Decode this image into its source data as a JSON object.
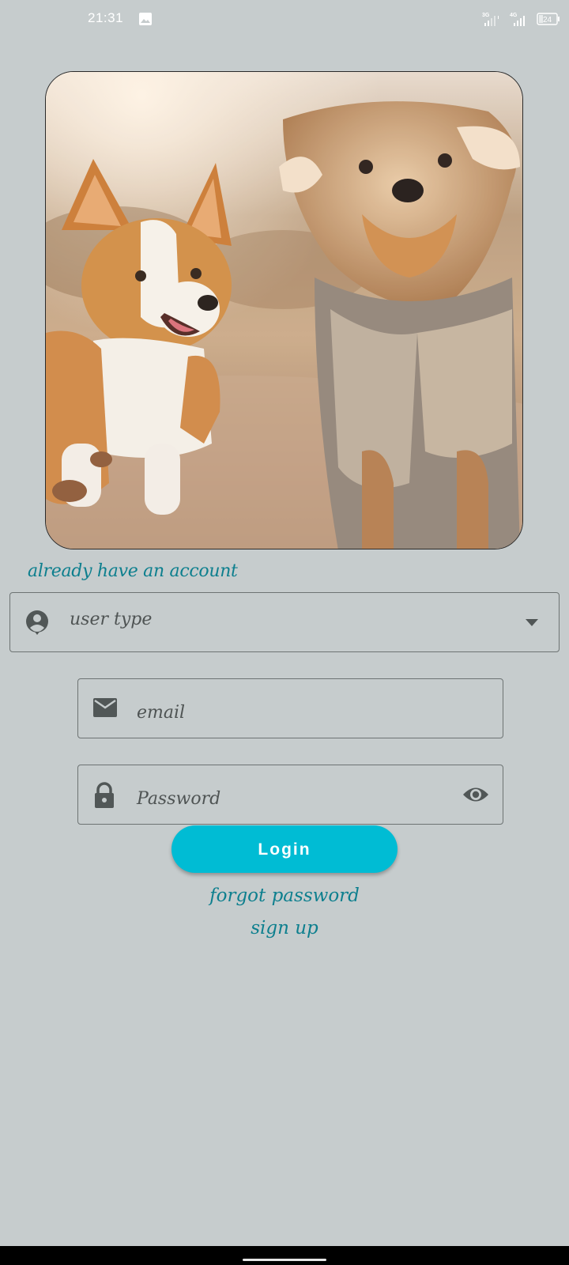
{
  "status_bar": {
    "time": "21:31",
    "gallery_icon": "image-icon",
    "network_1": "3G",
    "network_2": "4G",
    "battery": "24"
  },
  "hero": {
    "image": "two-dogs-photo"
  },
  "heading": "already have an account",
  "user_type": {
    "value": "user type",
    "icon": "account-circle-icon"
  },
  "email": {
    "placeholder": "email",
    "icon": "mail-icon"
  },
  "password": {
    "placeholder": "Password",
    "icon": "lock-icon",
    "toggle_icon": "eye-icon"
  },
  "login_label": "Login",
  "forgot_label": "forgot password",
  "signup_label": "sign up",
  "colors": {
    "background": "#c6cccd",
    "accent": "#00bcd4",
    "link": "#0d7f8e",
    "hint": "#4f5454"
  }
}
